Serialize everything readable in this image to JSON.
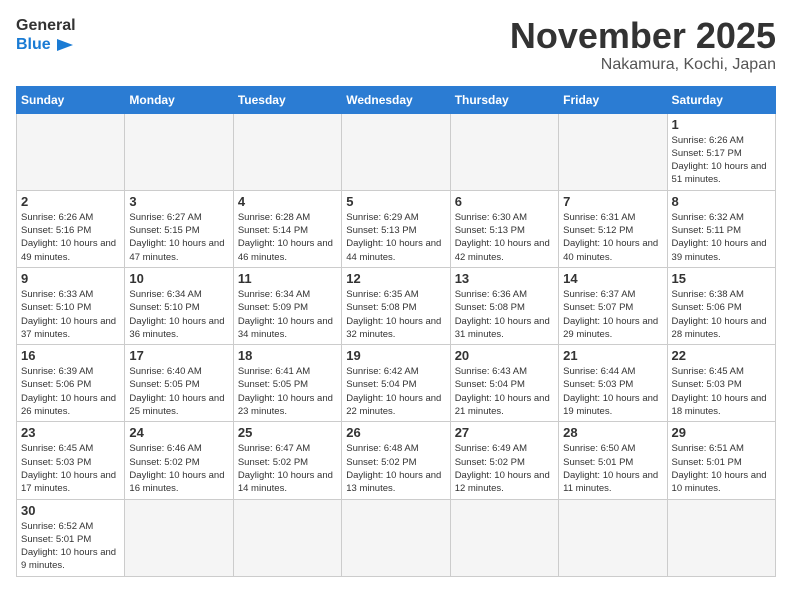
{
  "header": {
    "logo_general": "General",
    "logo_blue": "Blue",
    "month_title": "November 2025",
    "location": "Nakamura, Kochi, Japan"
  },
  "weekdays": [
    "Sunday",
    "Monday",
    "Tuesday",
    "Wednesday",
    "Thursday",
    "Friday",
    "Saturday"
  ],
  "days": [
    {
      "date": "",
      "empty": true
    },
    {
      "date": "",
      "empty": true
    },
    {
      "date": "",
      "empty": true
    },
    {
      "date": "",
      "empty": true
    },
    {
      "date": "",
      "empty": true
    },
    {
      "date": "",
      "empty": true
    },
    {
      "date": "1",
      "sunrise": "Sunrise: 6:26 AM",
      "sunset": "Sunset: 5:17 PM",
      "daylight": "Daylight: 10 hours and 51 minutes."
    },
    {
      "date": "2",
      "sunrise": "Sunrise: 6:26 AM",
      "sunset": "Sunset: 5:16 PM",
      "daylight": "Daylight: 10 hours and 49 minutes."
    },
    {
      "date": "3",
      "sunrise": "Sunrise: 6:27 AM",
      "sunset": "Sunset: 5:15 PM",
      "daylight": "Daylight: 10 hours and 47 minutes."
    },
    {
      "date": "4",
      "sunrise": "Sunrise: 6:28 AM",
      "sunset": "Sunset: 5:14 PM",
      "daylight": "Daylight: 10 hours and 46 minutes."
    },
    {
      "date": "5",
      "sunrise": "Sunrise: 6:29 AM",
      "sunset": "Sunset: 5:13 PM",
      "daylight": "Daylight: 10 hours and 44 minutes."
    },
    {
      "date": "6",
      "sunrise": "Sunrise: 6:30 AM",
      "sunset": "Sunset: 5:13 PM",
      "daylight": "Daylight: 10 hours and 42 minutes."
    },
    {
      "date": "7",
      "sunrise": "Sunrise: 6:31 AM",
      "sunset": "Sunset: 5:12 PM",
      "daylight": "Daylight: 10 hours and 40 minutes."
    },
    {
      "date": "8",
      "sunrise": "Sunrise: 6:32 AM",
      "sunset": "Sunset: 5:11 PM",
      "daylight": "Daylight: 10 hours and 39 minutes."
    },
    {
      "date": "9",
      "sunrise": "Sunrise: 6:33 AM",
      "sunset": "Sunset: 5:10 PM",
      "daylight": "Daylight: 10 hours and 37 minutes."
    },
    {
      "date": "10",
      "sunrise": "Sunrise: 6:34 AM",
      "sunset": "Sunset: 5:10 PM",
      "daylight": "Daylight: 10 hours and 36 minutes."
    },
    {
      "date": "11",
      "sunrise": "Sunrise: 6:34 AM",
      "sunset": "Sunset: 5:09 PM",
      "daylight": "Daylight: 10 hours and 34 minutes."
    },
    {
      "date": "12",
      "sunrise": "Sunrise: 6:35 AM",
      "sunset": "Sunset: 5:08 PM",
      "daylight": "Daylight: 10 hours and 32 minutes."
    },
    {
      "date": "13",
      "sunrise": "Sunrise: 6:36 AM",
      "sunset": "Sunset: 5:08 PM",
      "daylight": "Daylight: 10 hours and 31 minutes."
    },
    {
      "date": "14",
      "sunrise": "Sunrise: 6:37 AM",
      "sunset": "Sunset: 5:07 PM",
      "daylight": "Daylight: 10 hours and 29 minutes."
    },
    {
      "date": "15",
      "sunrise": "Sunrise: 6:38 AM",
      "sunset": "Sunset: 5:06 PM",
      "daylight": "Daylight: 10 hours and 28 minutes."
    },
    {
      "date": "16",
      "sunrise": "Sunrise: 6:39 AM",
      "sunset": "Sunset: 5:06 PM",
      "daylight": "Daylight: 10 hours and 26 minutes."
    },
    {
      "date": "17",
      "sunrise": "Sunrise: 6:40 AM",
      "sunset": "Sunset: 5:05 PM",
      "daylight": "Daylight: 10 hours and 25 minutes."
    },
    {
      "date": "18",
      "sunrise": "Sunrise: 6:41 AM",
      "sunset": "Sunset: 5:05 PM",
      "daylight": "Daylight: 10 hours and 23 minutes."
    },
    {
      "date": "19",
      "sunrise": "Sunrise: 6:42 AM",
      "sunset": "Sunset: 5:04 PM",
      "daylight": "Daylight: 10 hours and 22 minutes."
    },
    {
      "date": "20",
      "sunrise": "Sunrise: 6:43 AM",
      "sunset": "Sunset: 5:04 PM",
      "daylight": "Daylight: 10 hours and 21 minutes."
    },
    {
      "date": "21",
      "sunrise": "Sunrise: 6:44 AM",
      "sunset": "Sunset: 5:03 PM",
      "daylight": "Daylight: 10 hours and 19 minutes."
    },
    {
      "date": "22",
      "sunrise": "Sunrise: 6:45 AM",
      "sunset": "Sunset: 5:03 PM",
      "daylight": "Daylight: 10 hours and 18 minutes."
    },
    {
      "date": "23",
      "sunrise": "Sunrise: 6:45 AM",
      "sunset": "Sunset: 5:03 PM",
      "daylight": "Daylight: 10 hours and 17 minutes."
    },
    {
      "date": "24",
      "sunrise": "Sunrise: 6:46 AM",
      "sunset": "Sunset: 5:02 PM",
      "daylight": "Daylight: 10 hours and 16 minutes."
    },
    {
      "date": "25",
      "sunrise": "Sunrise: 6:47 AM",
      "sunset": "Sunset: 5:02 PM",
      "daylight": "Daylight: 10 hours and 14 minutes."
    },
    {
      "date": "26",
      "sunrise": "Sunrise: 6:48 AM",
      "sunset": "Sunset: 5:02 PM",
      "daylight": "Daylight: 10 hours and 13 minutes."
    },
    {
      "date": "27",
      "sunrise": "Sunrise: 6:49 AM",
      "sunset": "Sunset: 5:02 PM",
      "daylight": "Daylight: 10 hours and 12 minutes."
    },
    {
      "date": "28",
      "sunrise": "Sunrise: 6:50 AM",
      "sunset": "Sunset: 5:01 PM",
      "daylight": "Daylight: 10 hours and 11 minutes."
    },
    {
      "date": "29",
      "sunrise": "Sunrise: 6:51 AM",
      "sunset": "Sunset: 5:01 PM",
      "daylight": "Daylight: 10 hours and 10 minutes."
    },
    {
      "date": "30",
      "sunrise": "Sunrise: 6:52 AM",
      "sunset": "Sunset: 5:01 PM",
      "daylight": "Daylight: 10 hours and 9 minutes."
    }
  ]
}
